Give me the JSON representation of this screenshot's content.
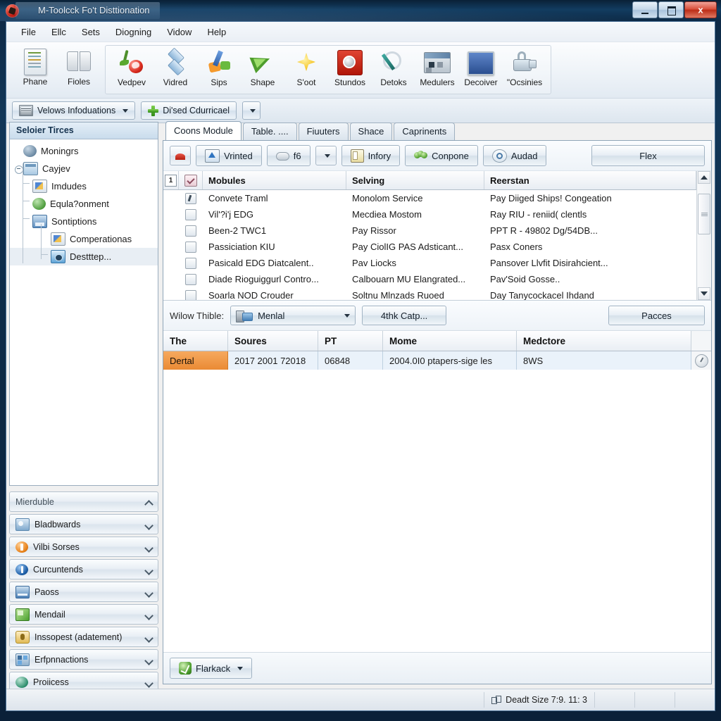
{
  "window": {
    "title": "M-Toolcck Fo't Disttionation",
    "app_icon": "app-logo-icon",
    "minimize_label": "",
    "maximize_label": "",
    "close_label": "x"
  },
  "menubar": {
    "items": [
      {
        "label": "File"
      },
      {
        "label": "Ellc"
      },
      {
        "label": "Sets"
      },
      {
        "label": "Diogning"
      },
      {
        "label": "Vidow"
      },
      {
        "label": "Help"
      }
    ]
  },
  "ribbon": {
    "group1": [
      {
        "label": "Phane",
        "icon": "document-icon"
      },
      {
        "label": "Fioles",
        "icon": "book-icon"
      }
    ],
    "group2": [
      {
        "label": "Vedpev",
        "icon": "cherry-icon"
      },
      {
        "label": "Vidred",
        "icon": "diamond-stack-icon"
      },
      {
        "label": "Sips",
        "icon": "pen-shapes-icon"
      },
      {
        "label": "Shape",
        "icon": "green-arrow-icon"
      },
      {
        "label": "S'oot",
        "icon": "star-icon"
      },
      {
        "label": "Stundos",
        "icon": "no-entry-icon"
      },
      {
        "label": "Detoks",
        "icon": "circle-pen-icon"
      },
      {
        "label": "Medulers",
        "icon": "control-panel-icon"
      },
      {
        "label": "Decoiver",
        "icon": "blue-screen-icon"
      },
      {
        "label": "\"Ocsinies",
        "icon": "lock-icon"
      }
    ]
  },
  "quickaccess": {
    "dropdown_label": "Velows Infoduations",
    "dropdown_icon": "device-strip-icon",
    "action_label": "Di'sed Cdurricael",
    "action_icon": "green-plus-icon",
    "split_caret": "caret-down-icon"
  },
  "sidebar": {
    "tree_title": "Seloier Tirces",
    "tree": [
      {
        "label": "Moningrs",
        "icon": "globe-icon",
        "depth": 0,
        "expander": false,
        "selected": false
      },
      {
        "label": "Cayjev",
        "icon": "window-icon",
        "depth": 0,
        "expander": true,
        "selected": false
      },
      {
        "label": "Imdudes",
        "icon": "paint-icon",
        "depth": 1,
        "expander": false,
        "selected": false
      },
      {
        "label": "Equla?onment",
        "icon": "gear-icon",
        "depth": 1,
        "expander": false,
        "selected": false
      },
      {
        "label": "Sontiptions",
        "icon": "disk-icon",
        "depth": 1,
        "expander": false,
        "selected": false
      },
      {
        "label": "Comperationas",
        "icon": "paint-icon",
        "depth": 2,
        "expander": false,
        "selected": false
      },
      {
        "label": "Destttep...",
        "icon": "cam-icon",
        "depth": 2,
        "expander": false,
        "selected": true
      }
    ],
    "accordion": [
      {
        "label": "Mierduble",
        "icon": "none",
        "chevron": "up",
        "header": true
      },
      {
        "label": "Bladbwards",
        "icon": "monitor-icon",
        "chevron": "down",
        "header": false
      },
      {
        "label": "Vilbi Sorses",
        "icon": "orange-alert-icon",
        "chevron": "down",
        "header": false
      },
      {
        "label": "Curcuntends",
        "icon": "info-icon",
        "chevron": "down",
        "header": false
      },
      {
        "label": "Paoss",
        "icon": "card-icon",
        "chevron": "down",
        "header": false
      },
      {
        "label": "Mendail",
        "icon": "green-folder-icon",
        "chevron": "down",
        "header": false
      },
      {
        "label": "Inssopest (adatement)",
        "icon": "shield-lock-icon",
        "chevron": "down",
        "header": false
      },
      {
        "label": "Erfpnnactions",
        "icon": "screens-icon",
        "chevron": "down",
        "header": false
      },
      {
        "label": "Proiicess",
        "icon": "teal-globe-icon",
        "chevron": "down",
        "header": false
      }
    ]
  },
  "tabs": [
    {
      "label": "Coons Module",
      "active": true
    },
    {
      "label": "Table. ....",
      "active": false
    },
    {
      "label": "Fiuuters",
      "active": false
    },
    {
      "label": "Shace",
      "active": false
    },
    {
      "label": "Caprinents",
      "active": false
    }
  ],
  "toolbar": {
    "icon_button": "red-arc-icon",
    "buttons": [
      {
        "label": "Vrinted",
        "icon": "import-icon"
      },
      {
        "label": "f6",
        "icon": "cloud-icon"
      },
      {
        "label": "Infory",
        "icon": "yellow-doc-icon"
      },
      {
        "label": "Conpone",
        "icon": "green-dots-icon"
      },
      {
        "label": "Audad",
        "icon": "eyeglass-icon"
      }
    ],
    "split_caret": "caret-down-icon",
    "right_button": "Flex"
  },
  "module_list": {
    "headers": {
      "num": "1",
      "check": "checkbox-header-icon",
      "col_a": "Mobules",
      "col_b": "Selving",
      "col_c": "Reerstan"
    },
    "rows": [
      {
        "checked": true,
        "a": "Convete Traml",
        "b": "Monolom Service",
        "c": "Pay Diiged Ships! Congeation"
      },
      {
        "checked": false,
        "a": "Vil'?i'j EDG",
        "b": "Mecdiea Mostom",
        "c": "Ray RIU - reniid( clentls"
      },
      {
        "checked": false,
        "a": "Been-2 TWC1",
        "b": "Pay Rissor",
        "c": "PPT R - 49802 Dg/54DB..."
      },
      {
        "checked": false,
        "a": "Passiciation KIU",
        "b": "Pay CiolIG PAS Adsticant...",
        "c": "Pasx Coners"
      },
      {
        "checked": false,
        "a": "Pasicald EDG Diatcalent..",
        "b": "Pav Liocks",
        "c": "Pansover Llvfit Disirahcient..."
      },
      {
        "checked": false,
        "a": "Diade Rioguiggurl Contro...",
        "b": "Calbouarn MU Elangrated...",
        "c": "Pav'Soid Gosse.."
      },
      {
        "checked": false,
        "a": "Soarla NOD Crouder",
        "b": "Soltnu Mlnzads Ruoed",
        "c": "Day Tanycockacel  Ihdand"
      }
    ],
    "scroll_up": "scroll-up-arrow",
    "scroll_down": "scroll-down-arrow"
  },
  "midbar": {
    "label": "Wilow Thible:",
    "combo_value": "Menlal",
    "combo_icon": "device-combo-icon",
    "button_label": "4thk Catp...",
    "right_button_label": "Pacces"
  },
  "detail_grid": {
    "headers": [
      "The",
      "Soures",
      "PT",
      "Mome",
      "Medctore",
      ""
    ],
    "rows": [
      {
        "cells": [
          "Dertal",
          "2017 2001 72018",
          "06848",
          "2004.0I0 ptapers-sige les",
          "8WS"
        ],
        "icon": "row-action-icon"
      }
    ]
  },
  "panel_footer": {
    "button_label": "Flarkack",
    "button_icon": "green-check-badge-icon",
    "caret": "caret-down-icon"
  },
  "statusbar": {
    "icon": "size-icon",
    "text": "Deadt Size 7:9.  11: 3"
  }
}
